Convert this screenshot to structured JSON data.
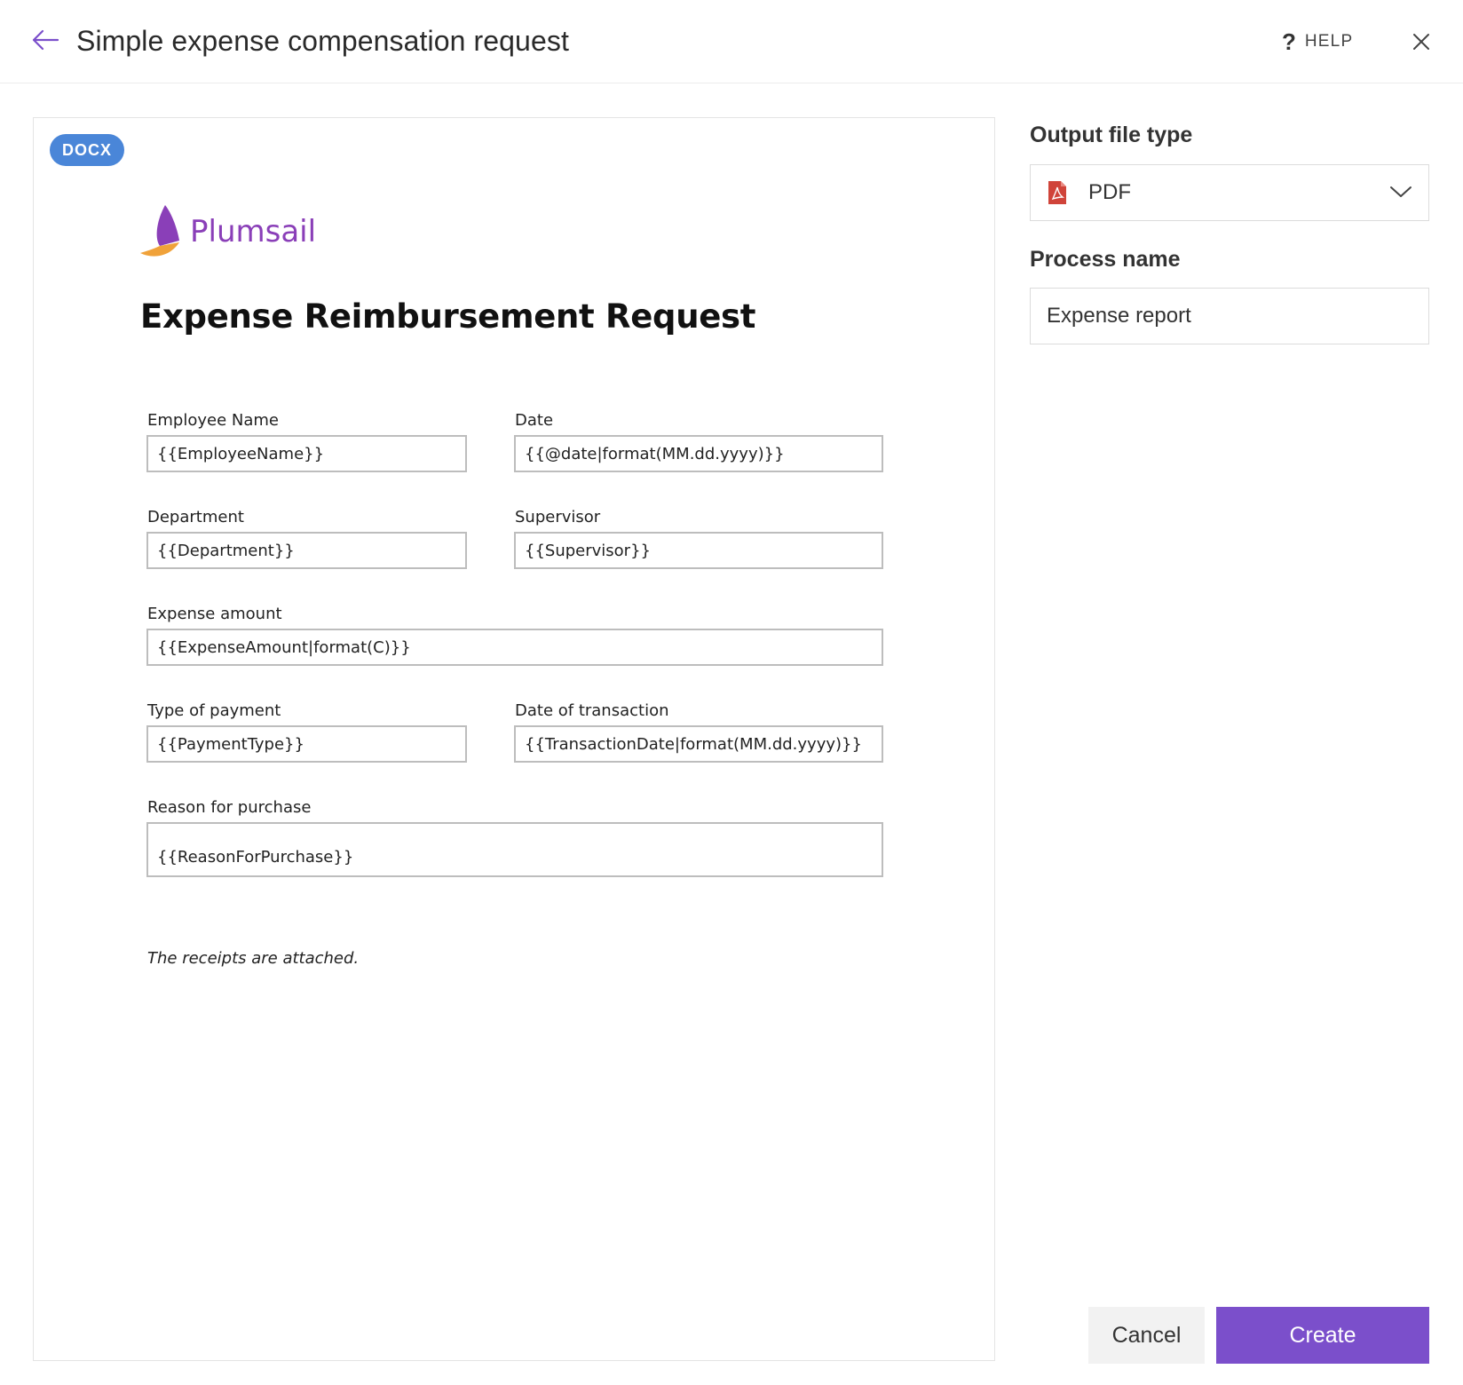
{
  "header": {
    "title": "Simple expense compensation request",
    "help_label": "HELP",
    "help_icon": "?"
  },
  "preview": {
    "badge": "DOCX",
    "logo_text": "Plumsail",
    "doc_title": "Expense Reimbursement Request",
    "fields": {
      "employee_name": {
        "label": "Employee Name",
        "value": "{{EmployeeName}}"
      },
      "date": {
        "label": "Date",
        "value": "{{@date|format(MM.dd.yyyy)}}"
      },
      "department": {
        "label": "Department",
        "value": "{{Department}}"
      },
      "supervisor": {
        "label": "Supervisor",
        "value": "{{Supervisor}}"
      },
      "expense_amount": {
        "label": "Expense amount",
        "value": "{{ExpenseAmount|format(C)}}"
      },
      "payment_type": {
        "label": "Type of payment",
        "value": "{{PaymentType}}"
      },
      "transaction_date": {
        "label": "Date of transaction",
        "value": "{{TransactionDate|format(MM.dd.yyyy)}}"
      },
      "reason": {
        "label": "Reason for purchase",
        "value": "{{ReasonForPurchase}}"
      }
    },
    "note": "The receipts are attached."
  },
  "settings": {
    "output_label": "Output file type",
    "output_value": "PDF",
    "output_icon": "pdf-icon",
    "process_label": "Process name",
    "process_value": "Expense report"
  },
  "actions": {
    "cancel": "Cancel",
    "create": "Create"
  },
  "colors": {
    "accent": "#7b4fcb",
    "badge": "#4a86d8",
    "logo": "#8a3fb8",
    "pdf": "#d0443a"
  }
}
